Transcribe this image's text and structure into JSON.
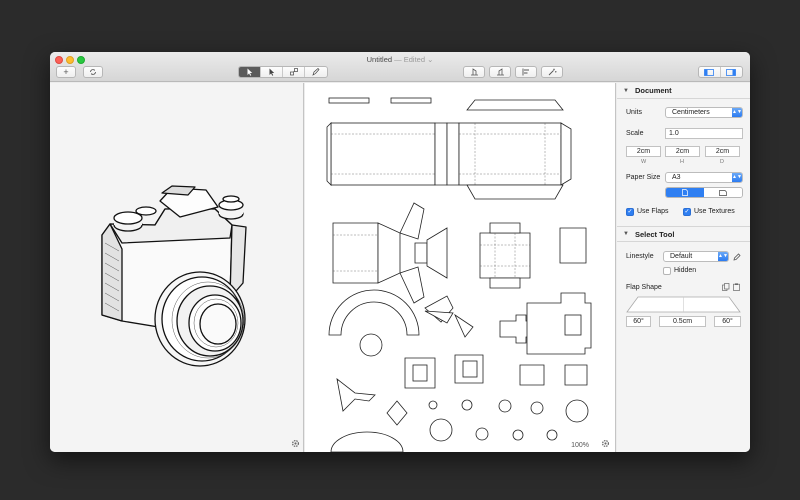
{
  "window": {
    "title": "Untitled",
    "title_suffix": " — Edited ⌄"
  },
  "toolbar": {
    "left_buttons": [
      "add",
      "sync"
    ],
    "tool_segment": [
      "select-tool",
      "direct-select-tool",
      "transform-tool",
      "pen-tool"
    ],
    "tool_selected_index": 0,
    "right_buttons": [
      "unfold-left",
      "unfold-right",
      "align",
      "magic"
    ],
    "panel_toggles": [
      "left-panel",
      "right-panel"
    ]
  },
  "canvas": {
    "zoom_label": "100%"
  },
  "inspector": {
    "document": {
      "header": "Document",
      "units_label": "Units",
      "units_value": "Centimeters",
      "scale_label": "Scale",
      "scale_value": "1.0",
      "dims": [
        {
          "value": "2cm",
          "sub": "W"
        },
        {
          "value": "2cm",
          "sub": "H"
        },
        {
          "value": "2cm",
          "sub": "D"
        }
      ],
      "paper_label": "Paper Size",
      "paper_value": "A3",
      "orientation_selected": "portrait",
      "use_flaps_label": "Use Flaps",
      "use_flaps": true,
      "use_textures_label": "Use Textures",
      "use_textures": true
    },
    "select_tool": {
      "header": "Select Tool",
      "linestyle_label": "Linestyle",
      "linestyle_value": "Default",
      "hidden_label": "Hidden",
      "hidden": false,
      "flap_shape_label": "Flap Shape",
      "flap_values": [
        "60°",
        "0.5cm",
        "60°"
      ]
    }
  },
  "colors": {
    "accent": "#2f7ff2",
    "close": "#fc5f57",
    "minimize": "#fdbc2e",
    "maximize": "#28c840"
  }
}
